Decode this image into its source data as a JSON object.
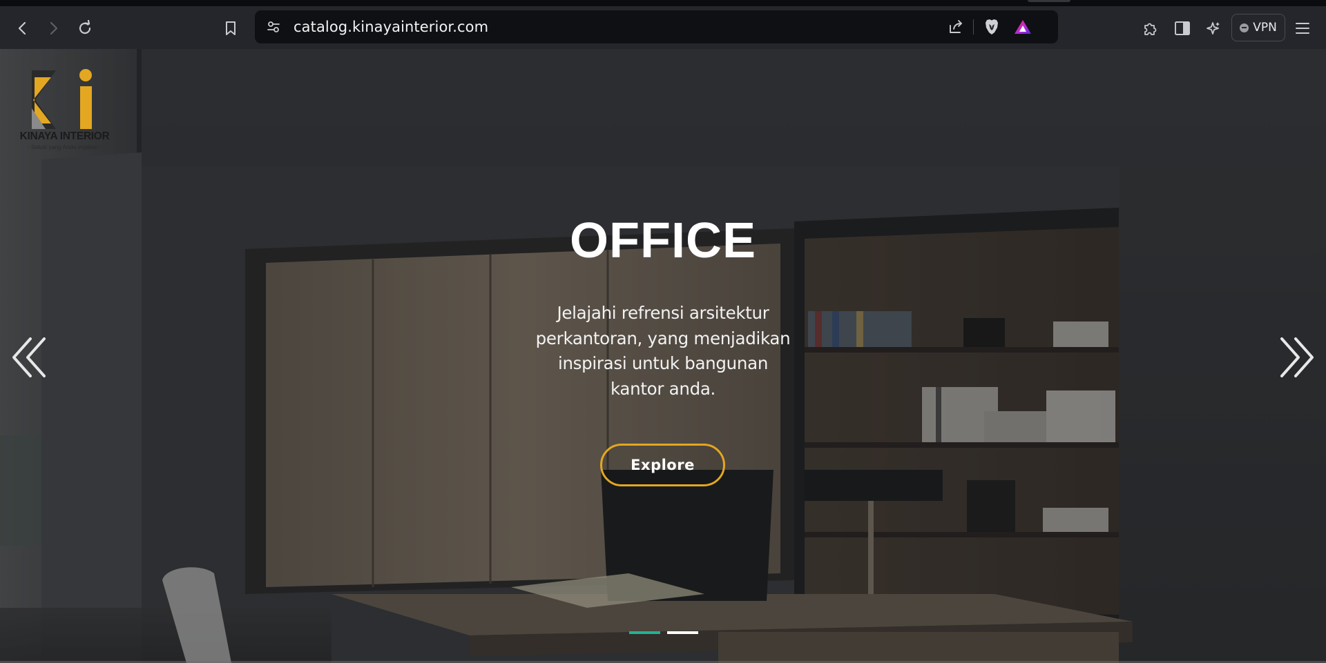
{
  "browser": {
    "url": "catalog.kinayainterior.com",
    "vpn_label": "VPN",
    "icons": [
      "back-icon",
      "forward-icon",
      "reload-icon",
      "bookmark-icon",
      "site-settings-icon",
      "share-icon",
      "brave-shields-icon",
      "brave-rewards-icon",
      "extensions-icon",
      "sidebar-icon",
      "leo-ai-icon",
      "menu-icon"
    ]
  },
  "logo": {
    "brand": "KINAYA INTERIOR",
    "tagline": "- Solusi yang Anda impikan -",
    "accent_color": "#e3a721"
  },
  "hero": {
    "title": "OFFICE",
    "description": "Jelajahi refrensi arsitektur perkantoran, yang menjadikan inspirasi untuk bangunan kantor anda.",
    "button_label": "Explore",
    "button_border_color": "#e3a721",
    "slide_count": 2,
    "active_slide": 1,
    "indicator_active_color": "#1fb394"
  }
}
